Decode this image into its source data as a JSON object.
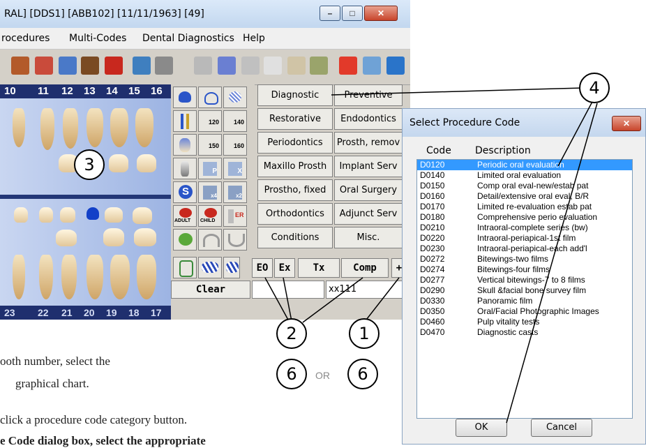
{
  "window": {
    "title": "RAL] [DDS1] [ABB102] [11/11/1963] [49]",
    "menu": [
      "rocedures",
      "Multi-Codes",
      "Dental Diagnostics",
      "Help"
    ]
  },
  "chart": {
    "upper_teeth": [
      "10",
      "11",
      "12",
      "13",
      "14",
      "15",
      "16"
    ],
    "lower_teeth": [
      "23",
      "22",
      "21",
      "20",
      "19",
      "18",
      "17"
    ]
  },
  "icon_buttons": [
    [
      "tooth-crown-icon",
      "tooth-crown-outline-icon",
      "tooth-hatched-icon"
    ],
    [
      "tooth-root-icon",
      "120",
      "140"
    ],
    [
      "tooth-perio-icon",
      "150",
      "160"
    ],
    [
      "tooth-implant-icon",
      "P",
      "X"
    ],
    [
      "S",
      "x4",
      "x2"
    ],
    [
      "ADULT",
      "CHILD",
      "ER"
    ],
    [
      "tooth-green-icon",
      "arch-upper-icon",
      "arch-lower-icon"
    ]
  ],
  "categories": [
    [
      "Diagnostic",
      "Preventive"
    ],
    [
      "Restorative",
      "Endodontics"
    ],
    [
      "Periodontics",
      "Prosth, remov"
    ],
    [
      "Maxillo Prosth",
      "Implant Serv"
    ],
    [
      "Prostho, fixed",
      "Oral Surgery"
    ],
    [
      "Orthodontics",
      "Adjunct Serv"
    ],
    [
      "Conditions",
      "Misc."
    ]
  ],
  "bottom": {
    "eo": "EO",
    "ex": "Ex",
    "tx": "Tx",
    "comp": "Comp",
    "plus": "+",
    "clear": "Clear",
    "code_value": "xx111"
  },
  "dialog": {
    "title": "Select Procedure Code",
    "col_code": "Code",
    "col_desc": "Description",
    "rows": [
      {
        "code": "D0120",
        "desc": "Periodic oral evaluation",
        "selected": true
      },
      {
        "code": "D0140",
        "desc": "Limited oral evaluation"
      },
      {
        "code": "D0150",
        "desc": "Comp oral eval-new/estab pat"
      },
      {
        "code": "D0160",
        "desc": "Detail/extensive oral eval, B/R"
      },
      {
        "code": "D0170",
        "desc": "Limited re-evaluation estab pat"
      },
      {
        "code": "D0180",
        "desc": "Comprehensive perio evaluation"
      },
      {
        "code": "D0210",
        "desc": "Intraoral-complete series (bw)"
      },
      {
        "code": "D0220",
        "desc": "Intraoral-periapical-1st film"
      },
      {
        "code": "D0230",
        "desc": "Intraoral-periapical-each add'l"
      },
      {
        "code": "D0272",
        "desc": "Bitewings-two films"
      },
      {
        "code": "D0274",
        "desc": "Bitewings-four films"
      },
      {
        "code": "D0277",
        "desc": "Vertical bitewings-7 to 8 films"
      },
      {
        "code": "D0290",
        "desc": "Skull &facial bone survey film"
      },
      {
        "code": "D0330",
        "desc": "Panoramic film"
      },
      {
        "code": "D0350",
        "desc": "Oral/Facial Photographic Images"
      },
      {
        "code": "D0460",
        "desc": "Pulp vitality tests"
      },
      {
        "code": "D0470",
        "desc": "Diagnostic casts"
      }
    ],
    "ok": "OK",
    "cancel": "Cancel"
  },
  "callouts": {
    "c1": "1",
    "c2": "2",
    "c3": "3",
    "c4": "4",
    "c6a": "6",
    "c6b": "6",
    "or": "OR"
  },
  "instructions": [
    "ooth number, select the",
    "graphical chart.",
    "click a procedure code category button.",
    "e Code dialog box, select the appropriate"
  ]
}
